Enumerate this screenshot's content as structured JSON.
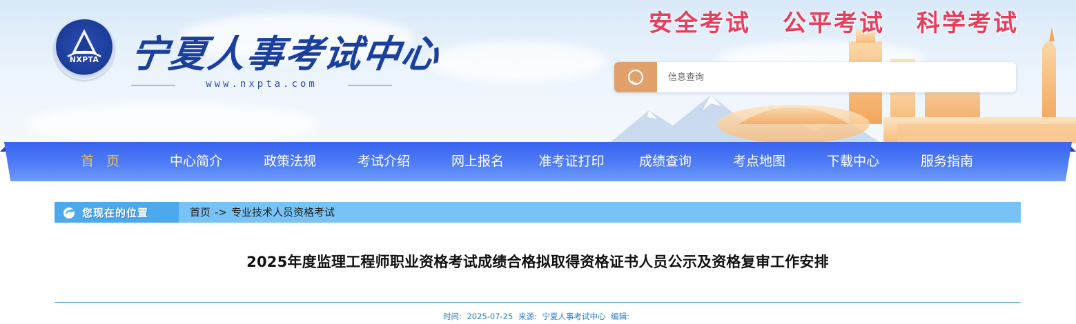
{
  "header": {
    "site_name": "宁夏人事考试中心",
    "logo_abbr": "NXPTA",
    "site_url": "www.nxpta.com",
    "slogans": [
      "安全考试",
      "公平考试",
      "科学考试"
    ]
  },
  "search": {
    "placeholder": "信息查询",
    "icon": "search-icon"
  },
  "nav": {
    "items": [
      {
        "label": "首 页",
        "active": true
      },
      {
        "label": "中心简介"
      },
      {
        "label": "政策法规"
      },
      {
        "label": "考试介绍"
      },
      {
        "label": "网上报名"
      },
      {
        "label": "准考证打印"
      },
      {
        "label": "成绩查询"
      },
      {
        "label": "考点地图"
      },
      {
        "label": "下载中心"
      },
      {
        "label": "服务指南"
      }
    ]
  },
  "breadcrumb": {
    "tag": "您现在的位置",
    "home": "首页",
    "separator": "->",
    "current": "专业技术人员资格考试"
  },
  "article": {
    "title": "2025年度监理工程师职业资格考试成绩合格拟取得资格证书人员公示及资格复审工作安排",
    "meta": {
      "time_label": "时间:",
      "time_value": "2025-07-25",
      "source_label": "来源:",
      "source_value": "宁夏人事考试中心",
      "editor_label": "编辑:",
      "editor_value": ""
    }
  },
  "colors": {
    "nav_blue": "#4f7df6",
    "nav_active": "#f3c64d",
    "slogan_red": "#e83d5c",
    "search_orange": "#e2a06a",
    "breadcrumb_blue": "#77c3f6",
    "meta_blue": "#2a7fc4"
  }
}
